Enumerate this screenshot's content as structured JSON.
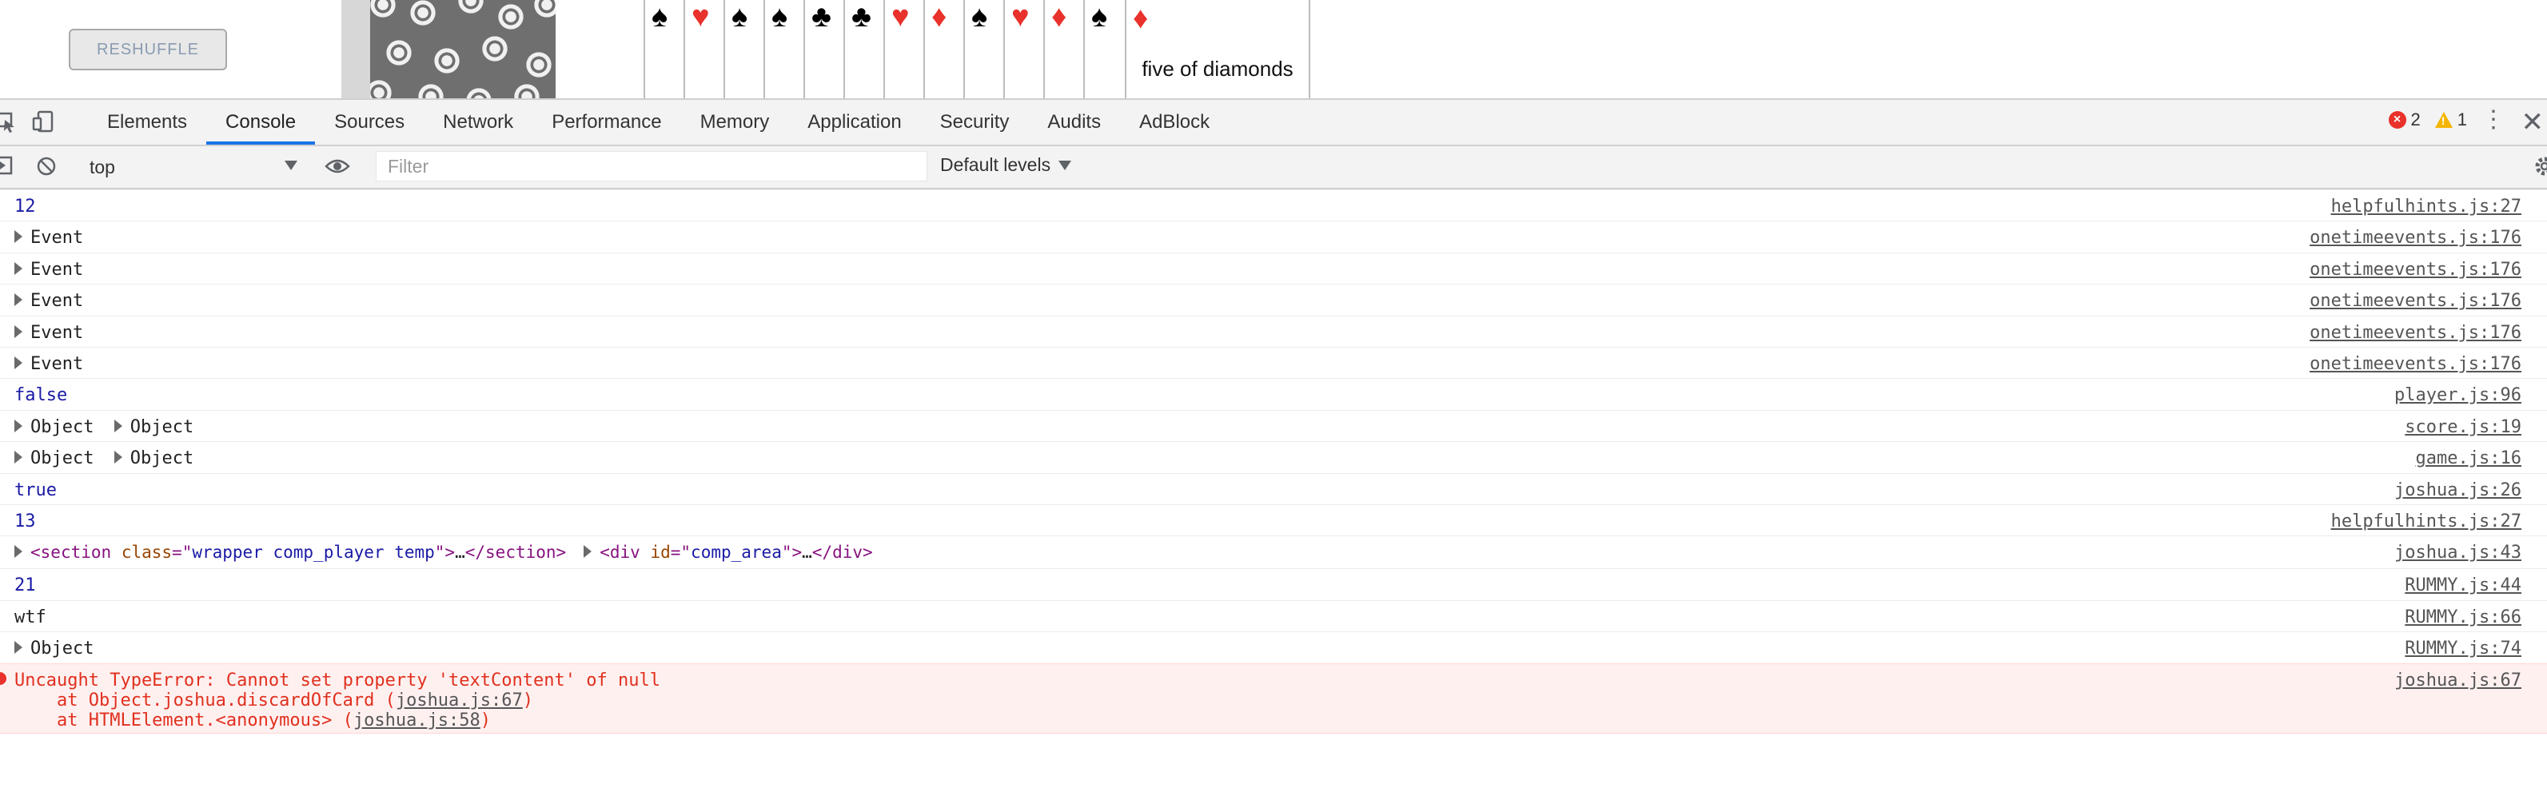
{
  "page": {
    "reshuffle_label": "RESHUFFLE",
    "hand": [
      {
        "rank": "",
        "suit": "♠",
        "color": "#000000"
      },
      {
        "rank": "",
        "suit": "♥",
        "color": "#e8322b"
      },
      {
        "rank": "",
        "suit": "♠",
        "color": "#000000"
      },
      {
        "rank": "",
        "suit": "♠",
        "color": "#000000"
      },
      {
        "rank": "",
        "suit": "♣",
        "color": "#000000"
      },
      {
        "rank": "",
        "suit": "♣",
        "color": "#000000"
      },
      {
        "rank": "",
        "suit": "♥",
        "color": "#e8322b"
      },
      {
        "rank": "",
        "suit": "♦",
        "color": "#e8322b"
      },
      {
        "rank": "",
        "suit": "♠",
        "color": "#000000"
      },
      {
        "rank": "",
        "suit": "♥",
        "color": "#e8322b"
      },
      {
        "rank": "",
        "suit": "♦",
        "color": "#e8322b"
      },
      {
        "rank": "",
        "suit": "♠",
        "color": "#000000"
      }
    ],
    "last_card": {
      "suit": "♦",
      "label": "five of diamonds"
    }
  },
  "devtools": {
    "tabs": [
      "Elements",
      "Console",
      "Sources",
      "Network",
      "Performance",
      "Memory",
      "Application",
      "Security",
      "Audits",
      "AdBlock"
    ],
    "active_tab": "Console",
    "error_count": "2",
    "warning_count": "1",
    "toolbar": {
      "context": "top",
      "filter_placeholder": "Filter",
      "levels": "Default levels"
    }
  },
  "console": {
    "rows": [
      {
        "kind": "number",
        "text": "12",
        "src": "helpfulhints.js:27"
      },
      {
        "kind": "object",
        "text": "Event",
        "src": "onetimeevents.js:176"
      },
      {
        "kind": "object",
        "text": "Event",
        "src": "onetimeevents.js:176"
      },
      {
        "kind": "object",
        "text": "Event",
        "src": "onetimeevents.js:176"
      },
      {
        "kind": "object",
        "text": "Event",
        "src": "onetimeevents.js:176"
      },
      {
        "kind": "object",
        "text": "Event",
        "src": "onetimeevents.js:176"
      },
      {
        "kind": "bool",
        "text": "false",
        "src": "player.js:96"
      },
      {
        "kind": "object2",
        "text": "Object",
        "text2": "Object",
        "src": "score.js:19"
      },
      {
        "kind": "object2",
        "text": "Object",
        "text2": "Object",
        "src": "game.js:16"
      },
      {
        "kind": "bool",
        "text": "true",
        "src": "joshua.js:26"
      },
      {
        "kind": "number",
        "text": "13",
        "src": "helpfulhints.js:27"
      },
      {
        "kind": "dom",
        "src": "joshua.js:43",
        "el1": {
          "tag": "section",
          "attr": "class",
          "value": "wrapper comp_player temp"
        },
        "el2": {
          "tag": "div",
          "attr": "id",
          "value": "comp_area"
        }
      },
      {
        "kind": "number",
        "text": "21",
        "src": "RUMMY.js:44"
      },
      {
        "kind": "plain",
        "text": "wtf",
        "src": "RUMMY.js:66"
      },
      {
        "kind": "object",
        "text": "Object",
        "src": "RUMMY.js:74"
      }
    ],
    "error": {
      "message": "Uncaught TypeError: Cannot set property 'textContent' of null",
      "stack1_prefix": "    at Object.joshua.discardOfCard (",
      "stack1_link": "joshua.js:67",
      "stack2_prefix": "    at HTMLElement.<anonymous> (",
      "stack2_link": "joshua.js:58",
      "src": "joshua.js:67"
    }
  }
}
